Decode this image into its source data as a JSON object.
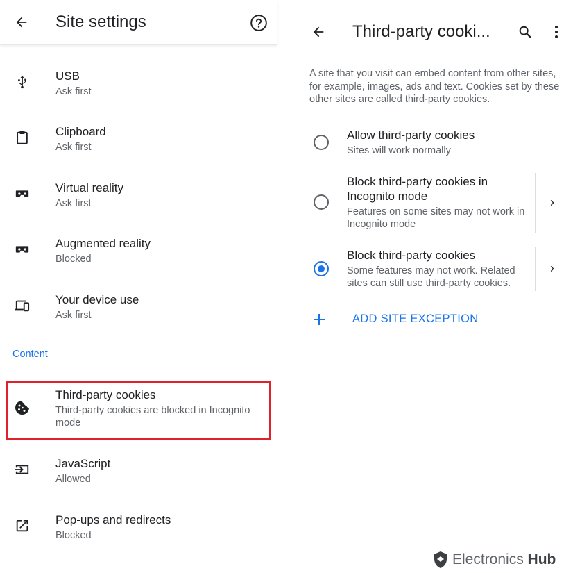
{
  "left": {
    "title": "Site settings",
    "items": [
      {
        "title": "USB",
        "subtitle": "Ask first",
        "icon": "usb-icon"
      },
      {
        "title": "Clipboard",
        "subtitle": "Ask first",
        "icon": "clipboard-icon"
      },
      {
        "title": "Virtual reality",
        "subtitle": "Ask first",
        "icon": "vr-headset-icon"
      },
      {
        "title": "Augmented reality",
        "subtitle": "Blocked",
        "icon": "ar-headset-icon"
      },
      {
        "title": "Your device use",
        "subtitle": "Ask first",
        "icon": "devices-icon"
      }
    ],
    "section": "Content",
    "content_items": [
      {
        "title": "Third-party cookies",
        "subtitle": "Third-party cookies are blocked in Incognito mode",
        "icon": "cookie-icon"
      },
      {
        "title": "JavaScript",
        "subtitle": "Allowed",
        "icon": "javascript-icon"
      },
      {
        "title": "Pop-ups and redirects",
        "subtitle": "Blocked",
        "icon": "popup-icon"
      }
    ]
  },
  "right": {
    "title": "Third-party cooki...",
    "description": "A site that you visit can embed content from other sites, for example, images, ads and text. Cookies set by these other sites are called third-party cookies.",
    "options": [
      {
        "title": "Allow third-party cookies",
        "subtitle": "Sites will work normally",
        "selected": false
      },
      {
        "title": "Block third-party cookies in Incognito mode",
        "subtitle": "Features on some sites may not work in Incognito mode",
        "selected": false
      },
      {
        "title": "Block third-party cookies",
        "subtitle": "Some features may not work. Related sites can still use third-party cookies.",
        "selected": true
      }
    ],
    "add_exception": "ADD SITE EXCEPTION"
  },
  "watermark": {
    "text": "Electronics",
    "bold": "Hub"
  },
  "colors": {
    "accent": "#1a73e8",
    "highlight": "#e0202a",
    "secondary_text": "#5f6368"
  }
}
